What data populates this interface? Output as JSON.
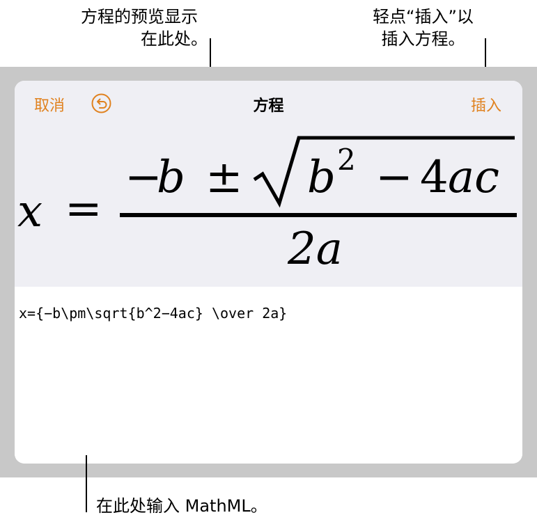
{
  "callouts": {
    "preview_line1": "方程的预览显示",
    "preview_line2": "在此处。",
    "insert_line1": "轻点“插入”以",
    "insert_line2": "插入方程。",
    "input_hint": "在此处输入 MathML。"
  },
  "navbar": {
    "cancel_label": "取消",
    "title": "方程",
    "insert_label": "插入",
    "undo_icon": "undo-circle-arrow-icon",
    "accent_color": "#E0821F"
  },
  "preview": {
    "lhs": "x",
    "equals": "=",
    "numerator": "−b ± √(b² − 4ac)",
    "denominator": "2a"
  },
  "editor": {
    "source": "x={−b\\pm\\sqrt{b^2−4ac} \\over 2a}"
  }
}
